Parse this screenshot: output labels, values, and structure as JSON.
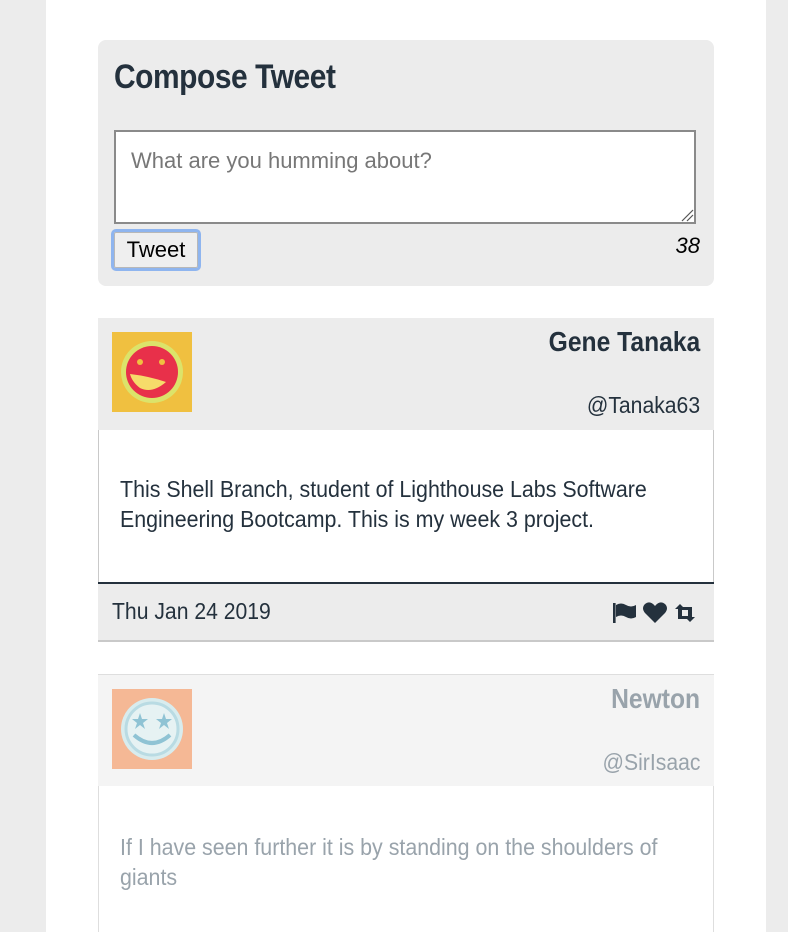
{
  "compose": {
    "title": "Compose Tweet",
    "placeholder": "What are you humming about?",
    "button_label": "Tweet",
    "counter": "38"
  },
  "tweets": [
    {
      "name": "Gene Tanaka",
      "handle": "@Tanaka63",
      "text": "This Shell Branch, student of Lighthouse Labs Software Engineering Bootcamp. This is my week 3 project.",
      "date": "Thu Jan 24 2019",
      "avatar_bg": "#f0c040",
      "avatar_face": "#e8304a",
      "actions": [
        "flag-icon",
        "heart-icon",
        "retweet-icon"
      ]
    },
    {
      "name": "Newton",
      "handle": "@SirIsaac",
      "text": "If I have seen further it is by standing on the shoulders of giants",
      "avatar_bg": "#f5b895",
      "avatar_face": "#cfe6ee"
    }
  ],
  "colors": {
    "text_dark": "#24313d",
    "text_faded": "#99a3ab",
    "panel_bg": "#ececec",
    "focus_ring": "#8fb5ef"
  }
}
